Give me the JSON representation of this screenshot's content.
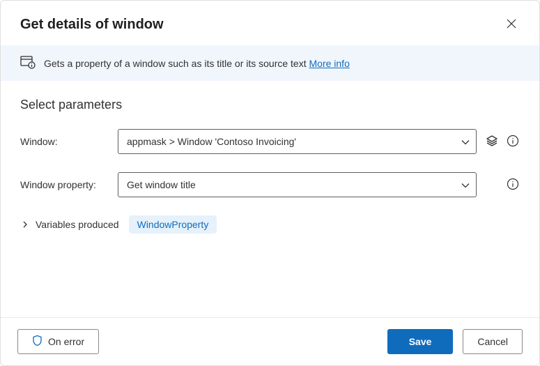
{
  "header": {
    "title": "Get details of window"
  },
  "infoBar": {
    "text": "Gets a property of a window such as its title or its source text ",
    "linkLabel": "More info"
  },
  "section": {
    "title": "Select parameters"
  },
  "form": {
    "windowLabel": "Window:",
    "windowValue": "appmask > Window 'Contoso Invoicing'",
    "propertyLabel": "Window property:",
    "propertyValue": "Get window title"
  },
  "variables": {
    "label": "Variables produced",
    "chip": "WindowProperty"
  },
  "footer": {
    "onError": "On error",
    "save": "Save",
    "cancel": "Cancel"
  }
}
